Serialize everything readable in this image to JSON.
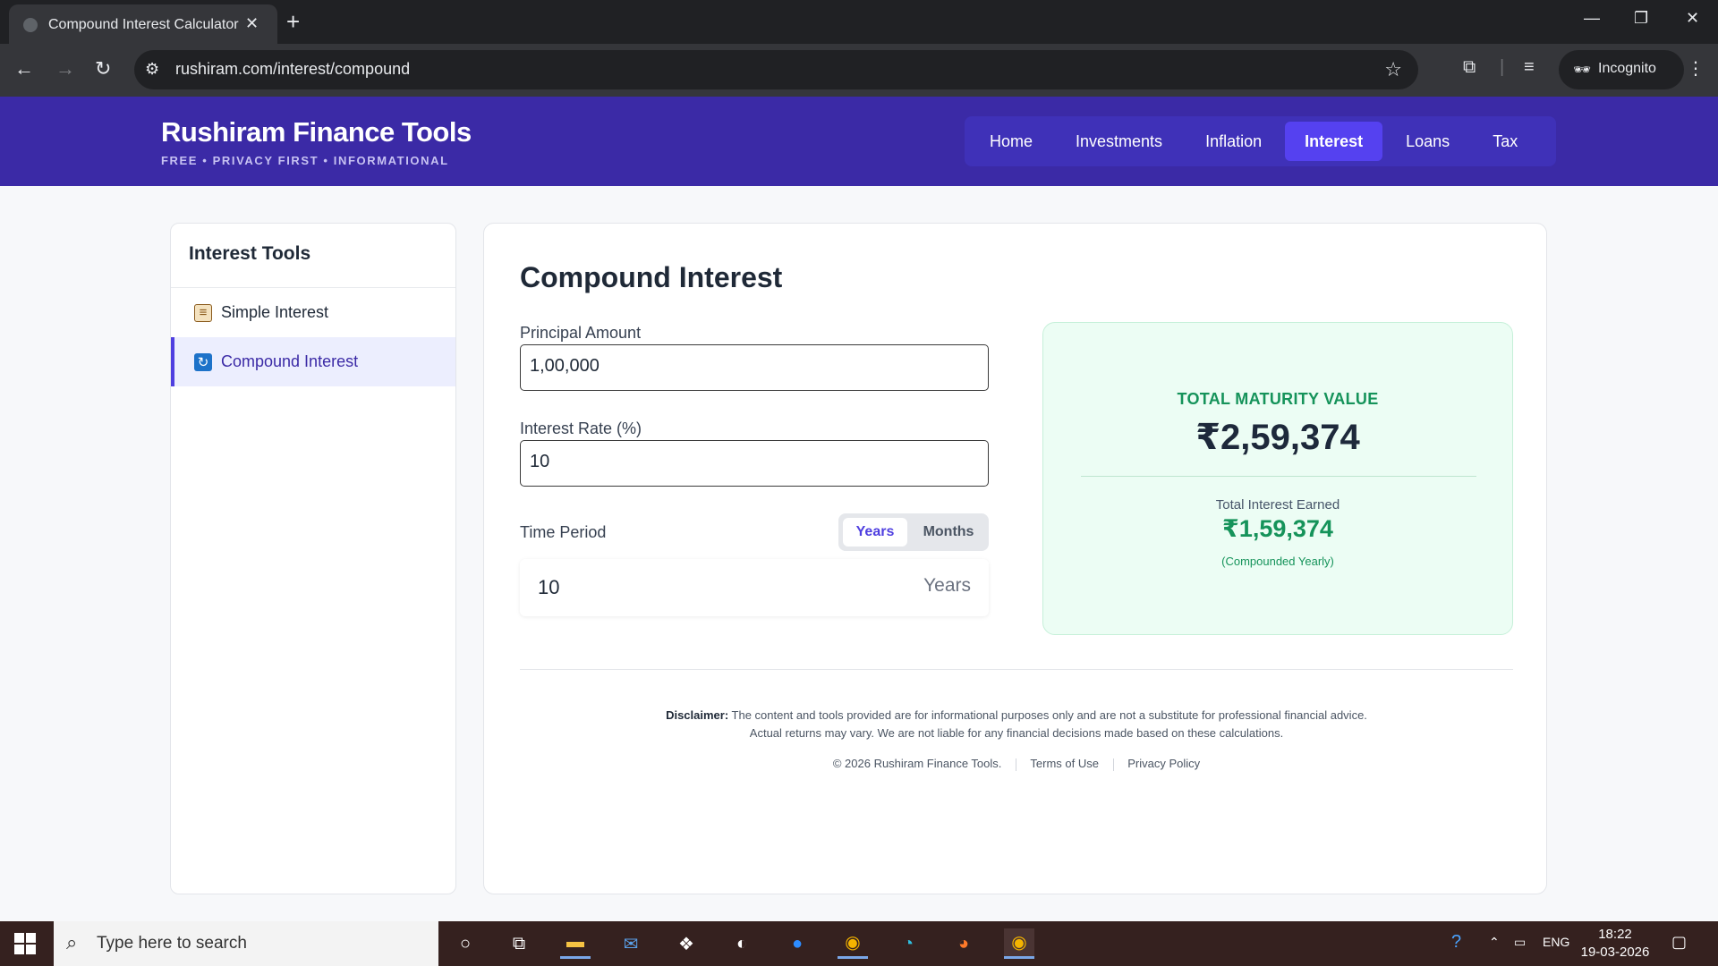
{
  "browser": {
    "tab_title": "Compound Interest Calculator |",
    "url": "rushiram.com/interest/compound",
    "incognito_label": "Incognito"
  },
  "site": {
    "brand": "Rushiram Finance Tools",
    "tagline": "FREE • PRIVACY FIRST • INFORMATIONAL",
    "nav": [
      "Home",
      "Investments",
      "Inflation",
      "Interest",
      "Loans",
      "Tax"
    ],
    "active_nav": "Interest"
  },
  "sidebar": {
    "title": "Interest Tools",
    "items": [
      {
        "label": "Simple Interest",
        "icon": "scroll-icon"
      },
      {
        "label": "Compound Interest",
        "icon": "cycle-icon"
      }
    ]
  },
  "main": {
    "title": "Compound Interest",
    "principal_label": "Principal Amount",
    "principal_value": "1,00,000",
    "rate_label": "Interest Rate (%)",
    "rate_value": "10",
    "period_label": "Time Period",
    "period_toggle": [
      "Years",
      "Months"
    ],
    "period_value": "10",
    "period_unit": "Years"
  },
  "result": {
    "maturity_label": "TOTAL MATURITY VALUE",
    "maturity_value": "₹2,59,374",
    "interest_label": "Total Interest Earned",
    "interest_value": "₹1,59,374",
    "compounding_note": "(Compounded Yearly)"
  },
  "footer": {
    "disclaimer_title": "Disclaimer:",
    "disclaimer_line1": "The content and tools provided are for informational purposes only and are not a substitute for professional financial advice.",
    "disclaimer_line2": "Actual returns may vary. We are not liable for any financial decisions made based on these calculations.",
    "copyright": "© 2026 Rushiram Finance Tools.",
    "terms": "Terms of Use",
    "privacy": "Privacy Policy"
  },
  "taskbar": {
    "search_placeholder": "Type here to search",
    "language": "ENG",
    "time": "18:22",
    "date": "19-03-2026"
  },
  "colors": {
    "header_bg": "#3b2aa6",
    "accent": "#4f3fe0",
    "success": "#15935a"
  }
}
